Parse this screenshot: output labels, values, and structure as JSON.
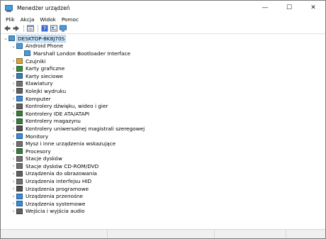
{
  "window": {
    "title": "Menedżer urządzeń",
    "min_glyph": "—",
    "max_glyph": "☐",
    "close_glyph": "✕"
  },
  "menu": [
    "Plik",
    "Akcja",
    "Widok",
    "Pomoc"
  ],
  "toolbar": [
    "back-arrow-icon",
    "forward-arrow-icon",
    "properties-icon",
    "help-icon",
    "device-view-icon",
    "monitor-icon"
  ],
  "tree": {
    "root": "DESKTOP-8K8J70S",
    "items": [
      {
        "label": "Android Phone",
        "expanded": true,
        "icon": "android-phone-icon",
        "color": "#4a9ad8",
        "children": [
          {
            "label": "Marshall London Bootloader Interface",
            "icon": "android-device-icon",
            "color": "#4a9ad8"
          }
        ]
      },
      {
        "label": "Czujniki",
        "icon": "sensor-icon",
        "color": "#d8a23a"
      },
      {
        "label": "Karty graficzne",
        "icon": "display-adapter-icon",
        "color": "#3a8a3a"
      },
      {
        "label": "Karty sieciowe",
        "icon": "network-adapter-icon",
        "color": "#3a7ab8"
      },
      {
        "label": "Klawiatury",
        "icon": "keyboard-icon",
        "color": "#707070"
      },
      {
        "label": "Kolejki wydruku",
        "icon": "printer-icon",
        "color": "#606060"
      },
      {
        "label": "Komputer",
        "icon": "computer-icon",
        "color": "#3a8ad8"
      },
      {
        "label": "Kontrolery dźwięku, wideo i gier",
        "icon": "sound-icon",
        "color": "#606060"
      },
      {
        "label": "Kontrolery IDE ATA/ATAPI",
        "icon": "ide-controller-icon",
        "color": "#3a7a3a"
      },
      {
        "label": "Kontrolery magazynu",
        "icon": "storage-controller-icon",
        "color": "#3a7a3a"
      },
      {
        "label": "Kontrolery uniwersalnej magistrali szeregowej",
        "icon": "usb-icon",
        "color": "#505050"
      },
      {
        "label": "Monitory",
        "icon": "monitor-icon",
        "color": "#3a8ad8"
      },
      {
        "label": "Mysz i inne urządzenia wskazujące",
        "icon": "mouse-icon",
        "color": "#707070"
      },
      {
        "label": "Procesory",
        "icon": "processor-icon",
        "color": "#3a7a3a"
      },
      {
        "label": "Stacje dysków",
        "icon": "disk-drive-icon",
        "color": "#707070"
      },
      {
        "label": "Stacje dysków CD-ROM/DVD",
        "icon": "dvd-drive-icon",
        "color": "#707070"
      },
      {
        "label": "Urządzenia do obrazowania",
        "icon": "imaging-icon",
        "color": "#606060"
      },
      {
        "label": "Urządzenia interfejsu HID",
        "icon": "hid-icon",
        "color": "#707070"
      },
      {
        "label": "Urządzenia programowe",
        "icon": "software-device-icon",
        "color": "#505050"
      },
      {
        "label": "Urządzenia przenośne",
        "icon": "portable-device-icon",
        "color": "#3a8ad8"
      },
      {
        "label": "Urządzenia systemowe",
        "icon": "system-device-icon",
        "color": "#3a8ad8"
      },
      {
        "label": "Wejścia i wyjścia audio",
        "icon": "audio-io-icon",
        "color": "#606060"
      }
    ]
  }
}
